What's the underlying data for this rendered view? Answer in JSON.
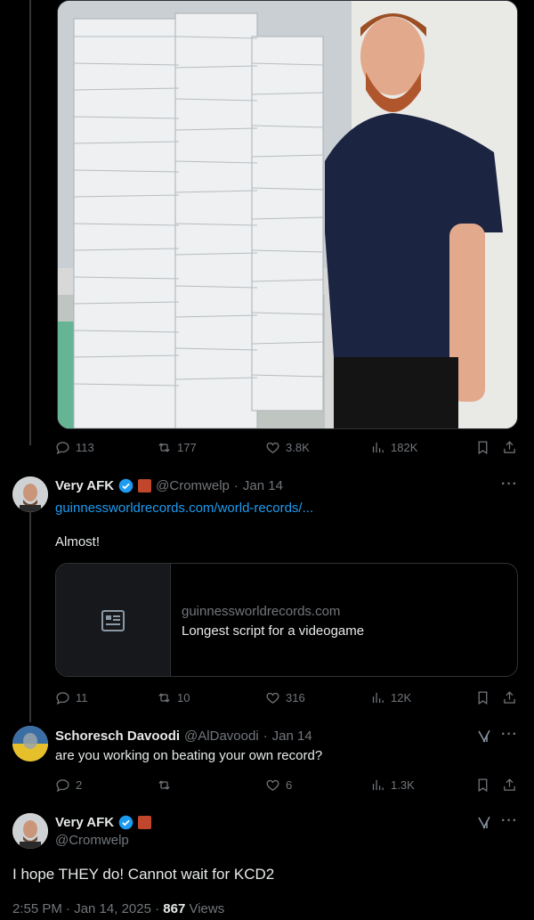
{
  "media_post": {
    "actions": {
      "replies": "113",
      "reposts": "177",
      "likes": "3.8K",
      "views": "182K"
    }
  },
  "reply1": {
    "name": "Very AFK",
    "handle": "@Cromwelp",
    "sep": "·",
    "date": "Jan 14",
    "link": "guinnessworldrecords.com/world-records/...",
    "text": "Almost!",
    "card": {
      "domain": "guinnessworldrecords.com",
      "title": "Longest script for a videogame"
    },
    "actions": {
      "replies": "11",
      "reposts": "10",
      "likes": "316",
      "views": "12K"
    }
  },
  "reply2": {
    "name": "Schoresch Davoodi",
    "handle": "@AlDavoodi",
    "sep": "·",
    "date": "Jan 14",
    "text": "are you working on beating your own record?",
    "actions": {
      "replies": "2",
      "reposts": "",
      "likes": "6",
      "views": "1.3K"
    }
  },
  "main_post": {
    "name": "Very AFK",
    "handle": "@Cromwelp",
    "text": "I hope THEY do! Cannot wait for KCD2",
    "time": "2:55 PM · Jan 14, 2025 ·",
    "views_count": "867",
    "views_label": "Views"
  },
  "more_label": "···",
  "colors": {
    "accent": "#1d9bf0",
    "muted": "#71767b",
    "text": "#e7e9ea",
    "border": "#2f3336"
  }
}
